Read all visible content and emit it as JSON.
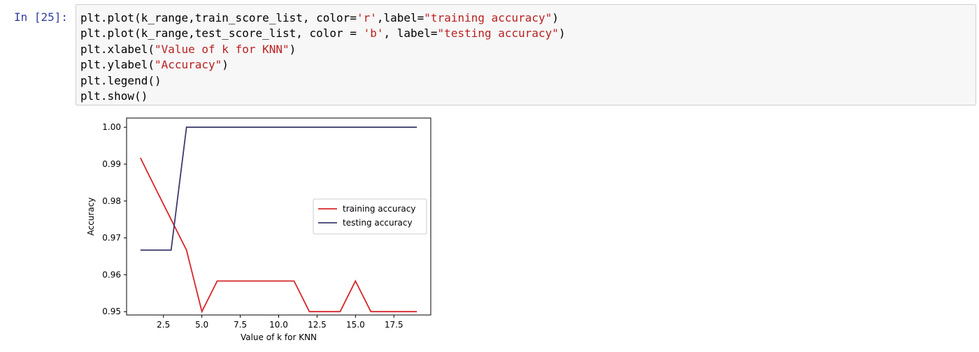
{
  "cell": {
    "prompt": "In [25]:",
    "code_lines": [
      [
        "plt.plot(k_range,train_score_list, color=",
        "'r'",
        ",label=",
        "\"training accuracy\"",
        ")"
      ],
      [
        "plt.plot(k_range,test_score_list, color = ",
        "'b'",
        ", label=",
        "\"testing accuracy\"",
        ")"
      ],
      [
        "plt.xlabel(",
        "\"Value of k for KNN\"",
        ")"
      ],
      [
        "plt.ylabel(",
        "\"Accuracy\"",
        ")"
      ],
      [
        "plt.legend()"
      ],
      [
        "plt.show()"
      ]
    ]
  },
  "colors": {
    "prompt": "#303f9f",
    "string": "#ba2121",
    "training": "#d62728",
    "testing": "#3b3b6e",
    "cell_bg": "#f7f7f7",
    "cell_border": "#cfcfcf"
  },
  "chart_data": {
    "type": "line",
    "xlabel": "Value of k for KNN",
    "ylabel": "Accuracy",
    "xlim": [
      0.1,
      19.9
    ],
    "ylim": [
      0.9491,
      1.0025
    ],
    "xticks": [
      2.5,
      5.0,
      7.5,
      10.0,
      12.5,
      15.0,
      17.5
    ],
    "xtick_labels": [
      "2.5",
      "5.0",
      "7.5",
      "10.0",
      "12.5",
      "15.0",
      "17.5"
    ],
    "yticks": [
      0.95,
      0.96,
      0.97,
      0.98,
      0.99,
      1.0
    ],
    "ytick_labels": [
      "0.95",
      "0.96",
      "0.97",
      "0.98",
      "0.99",
      "1.00"
    ],
    "legend_position": "center-right",
    "x": [
      1,
      2,
      3,
      4,
      5,
      6,
      7,
      8,
      9,
      10,
      11,
      12,
      13,
      14,
      15,
      16,
      17,
      18,
      19
    ],
    "series": [
      {
        "name": "training accuracy",
        "color": "#d62728",
        "values": [
          0.9917,
          0.9833,
          0.975,
          0.9667,
          0.95,
          0.9583,
          0.9583,
          0.9583,
          0.9583,
          0.9583,
          0.9583,
          0.95,
          0.95,
          0.95,
          0.9583,
          0.95,
          0.95,
          0.95,
          0.95
        ]
      },
      {
        "name": "testing accuracy",
        "color": "#3b3b6e",
        "values": [
          0.9667,
          0.9667,
          0.9667,
          1.0,
          1.0,
          1.0,
          1.0,
          1.0,
          1.0,
          1.0,
          1.0,
          1.0,
          1.0,
          1.0,
          1.0,
          1.0,
          1.0,
          1.0,
          1.0
        ]
      }
    ]
  }
}
